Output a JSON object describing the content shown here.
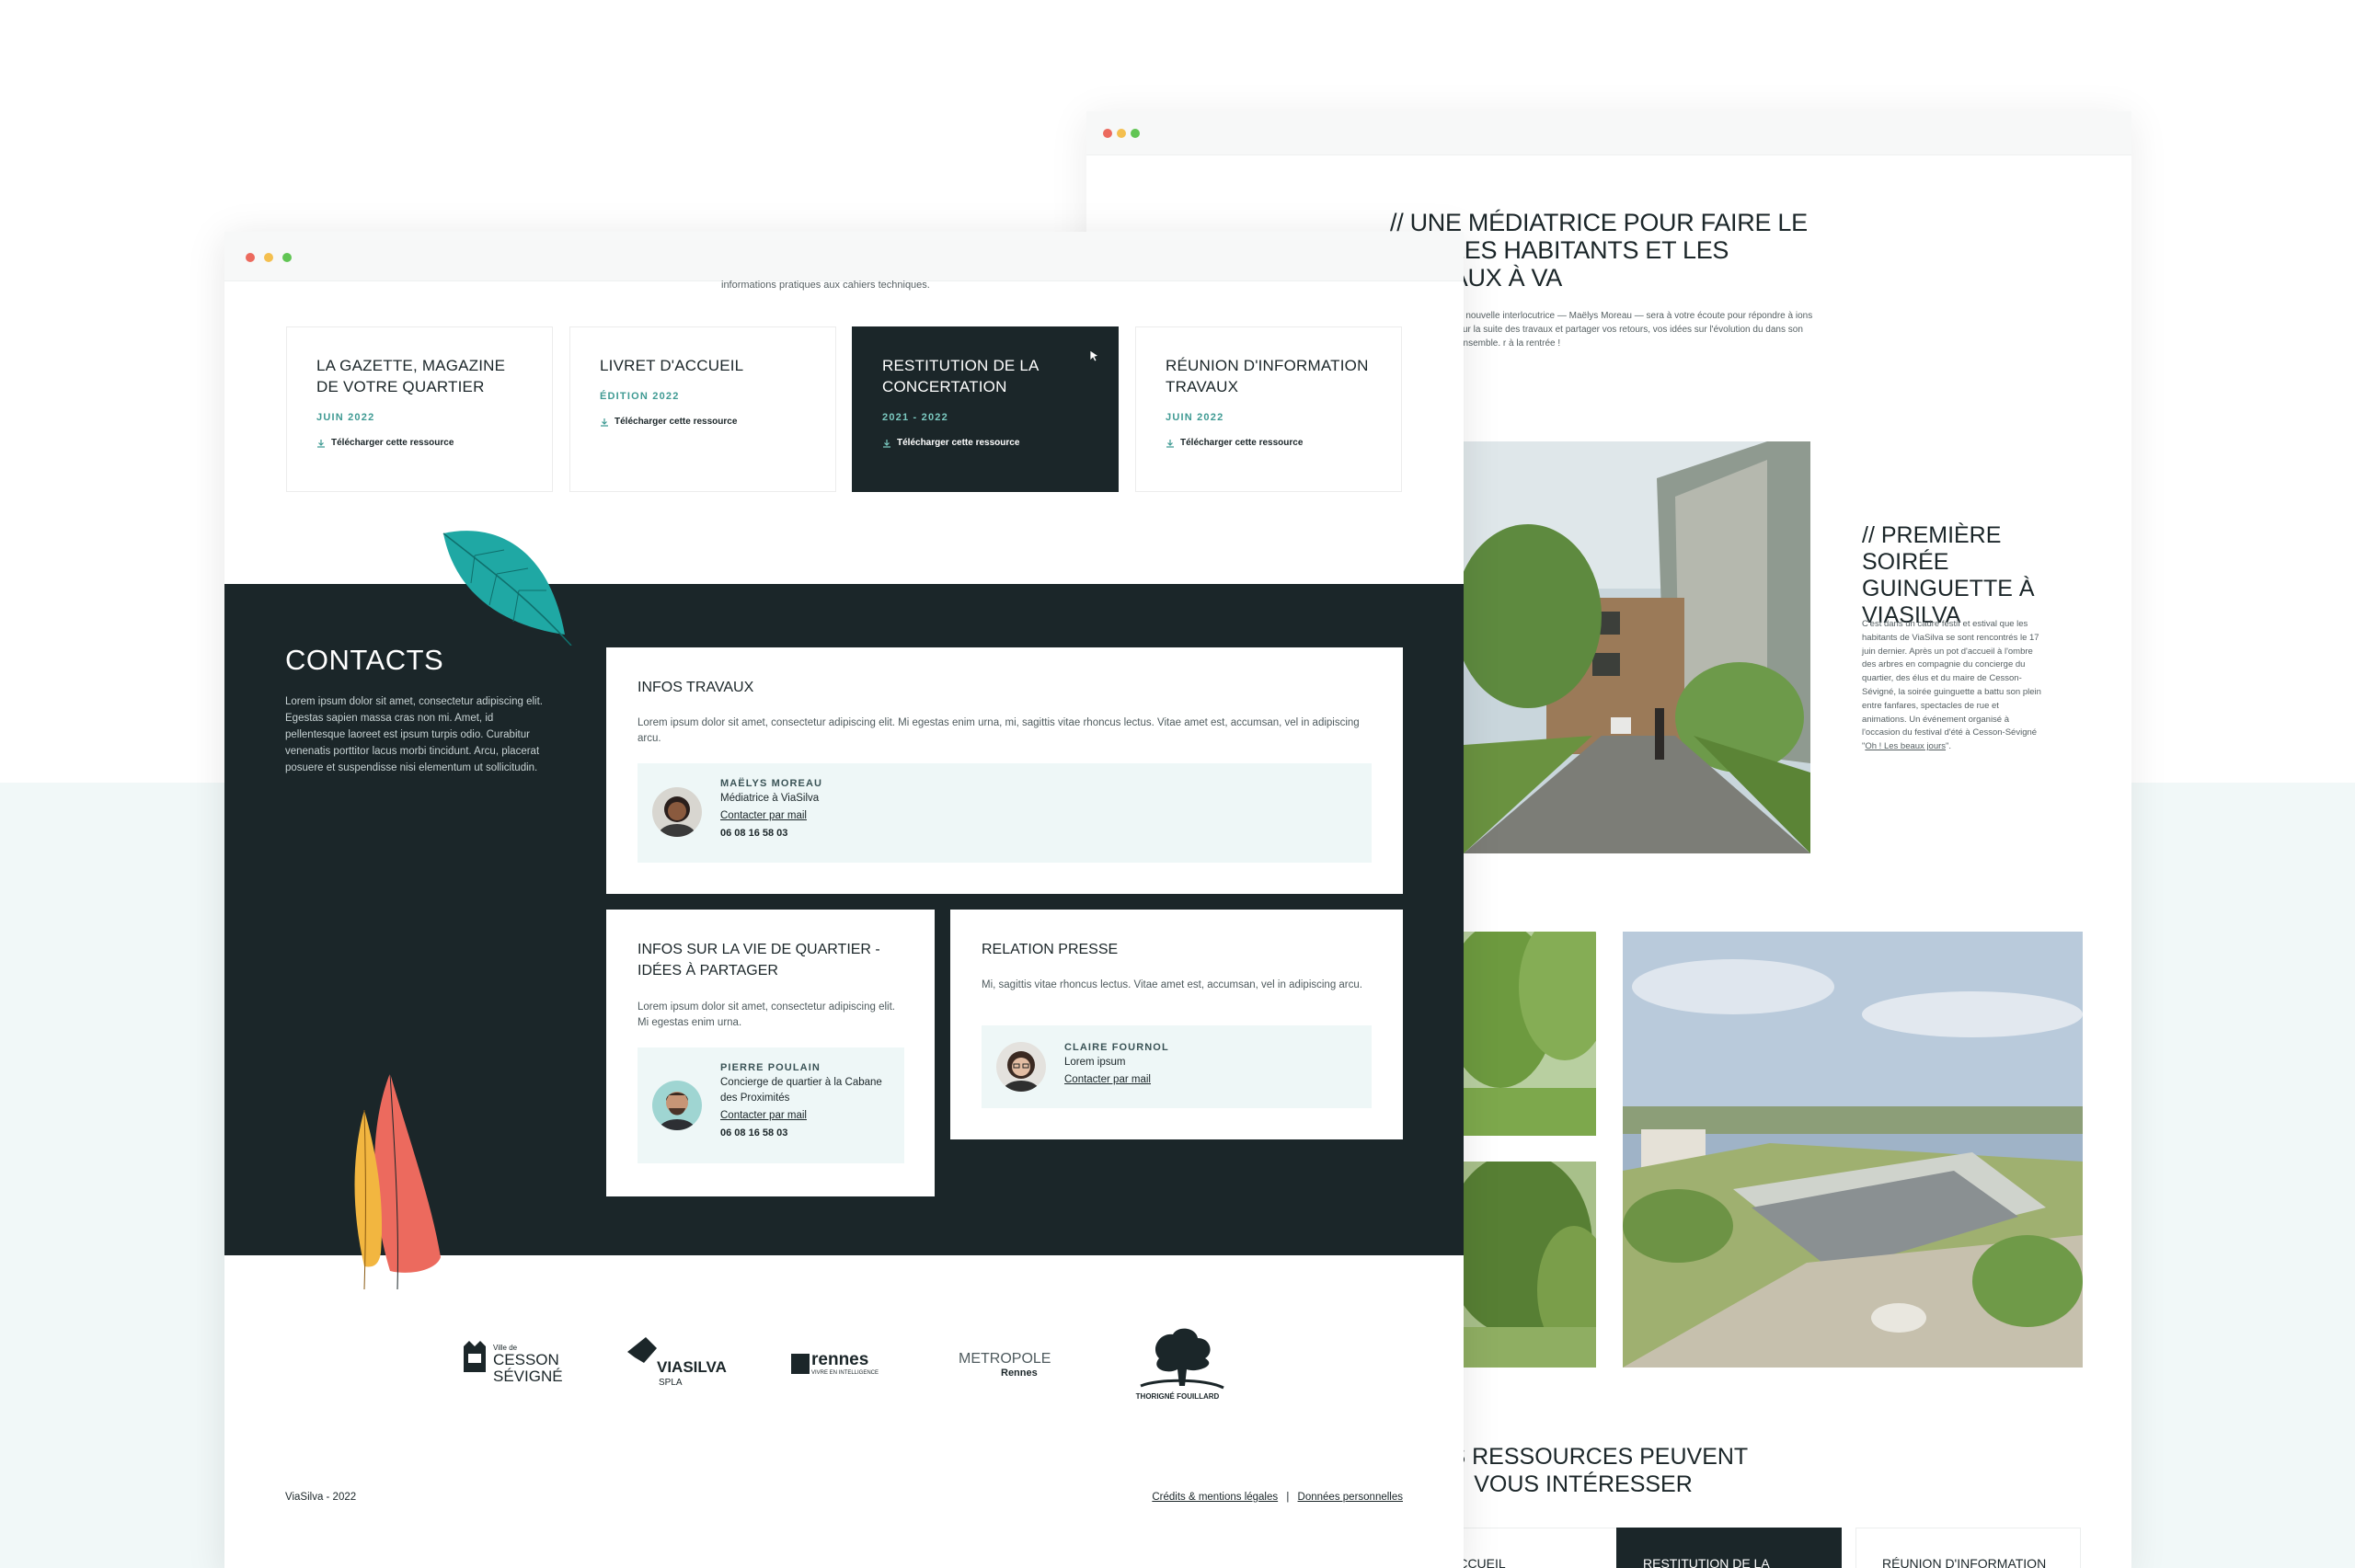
{
  "back_window": {
    "title": "// Une médiatrice pour faire le lien les habitants et les travaux à va",
    "intro": "e nouvelle interlocutrice — Maëlys Moreau — sera à votre écoute pour répondre à ions sur la suite des travaux et partager vos retours, vos idées sur l'évolution du dans son ensemble. r à la rentrée !",
    "section2_title": "// Première soirée guinguette à ViaSilva",
    "section2_body": "C'est dans un cadre festif et estival que les habitants de ViaSilva se sont rencontrés le 17 juin dernier. Après un pot d'accueil à l'ombre des arbres en compagnie du concierge du quartier, des élus et du maire de Cesson-Sévigné, la soirée guinguette a battu son plein entre fanfares, spectacles de rue et animations. Un événement organisé à l'occasion du festival d'été à Cesson-Sévigné \"",
    "section2_link": "Oh ! Les beaux jours",
    "section2_end": "\".",
    "resources_title": "Ces ressources peuvent vous intéresser",
    "cards": [
      "Accueil",
      "Restitution de la",
      "Réunion d'information"
    ]
  },
  "front_window": {
    "top_line": "informations pratiques aux cahiers techniques.",
    "resources": [
      {
        "title": "La Gazette, magazine de votre quartier",
        "date": "Juin 2022",
        "download": "Télécharger cette ressource",
        "dark": false
      },
      {
        "title": "Livret d'accueil",
        "date": "Édition 2022",
        "download": "Télécharger cette ressource",
        "dark": false
      },
      {
        "title": "Restitution de la concertation",
        "date": "2021 - 2022",
        "download": "Télécharger cette ressource",
        "dark": true
      },
      {
        "title": "Réunion d'information travaux",
        "date": "Juin 2022",
        "download": "Télécharger cette ressource",
        "dark": false
      }
    ],
    "contacts": {
      "title": "Contacts",
      "body": "Lorem ipsum dolor sit amet, consectetur adipiscing elit. Egestas sapien massa cras non mi. Amet, id pellentesque laoreet est ipsum turpis odio. Curabitur venenatis porttitor lacus morbi tincidunt. Arcu, placerat posuere et suspendisse nisi elementum ut sollicitudin.",
      "infos_travaux": {
        "title": "Infos travaux",
        "text": "Lorem ipsum dolor sit amet, consectetur adipiscing elit. Mi egestas enim urna, mi, sagittis vitae rhoncus lectus. Vitae amet est, accumsan, vel in adipiscing arcu.",
        "name": "Maëlys Moreau",
        "role": "Médiatrice à ViaSilva",
        "mail": "Contacter par mail",
        "tel": "06 08 16 58 03"
      },
      "vie_quartier": {
        "title": "Infos sur la vie de quartier - idées à partager",
        "text": "Lorem ipsum dolor sit amet, consectetur adipiscing elit. Mi egestas enim urna.",
        "name": "Pierre Poulain",
        "role": "Concierge de quartier à la Cabane des Proximités",
        "mail": "Contacter par mail",
        "tel": "06 08 16 58 03"
      },
      "presse": {
        "title": "Relation presse",
        "text": "Mi, sagittis vitae rhoncus lectus. Vitae amet est, accumsan, vel in adipiscing arcu.",
        "name": "Claire Fournol",
        "role": "Lorem ipsum",
        "mail": "Contacter par mail"
      }
    },
    "logos": {
      "cesson_small": "Ville de",
      "cesson_1": "CESSON",
      "cesson_2": "SÉVIGNÉ",
      "viasilva": "VIASILVA",
      "viasilva_sub": "SPLA",
      "rennes": "rennes",
      "rennes_sub": "VIVRE EN INTELLIGENCE",
      "metropole": "METROPOLE",
      "metropole_sub": "Rennes",
      "thorigne": "THORIGNÉ FOUILLARD"
    },
    "footer": {
      "left": "ViaSilva - 2022",
      "credits": "Crédits & mentions légales",
      "separator": "|",
      "privacy": "Données personnelles"
    }
  },
  "colors": {
    "dark": "#1b2629",
    "accent": "#3f9a93",
    "teal_leaf": "#1fa8a4",
    "coral": "#ec6a5e",
    "yellow": "#f2b640"
  }
}
